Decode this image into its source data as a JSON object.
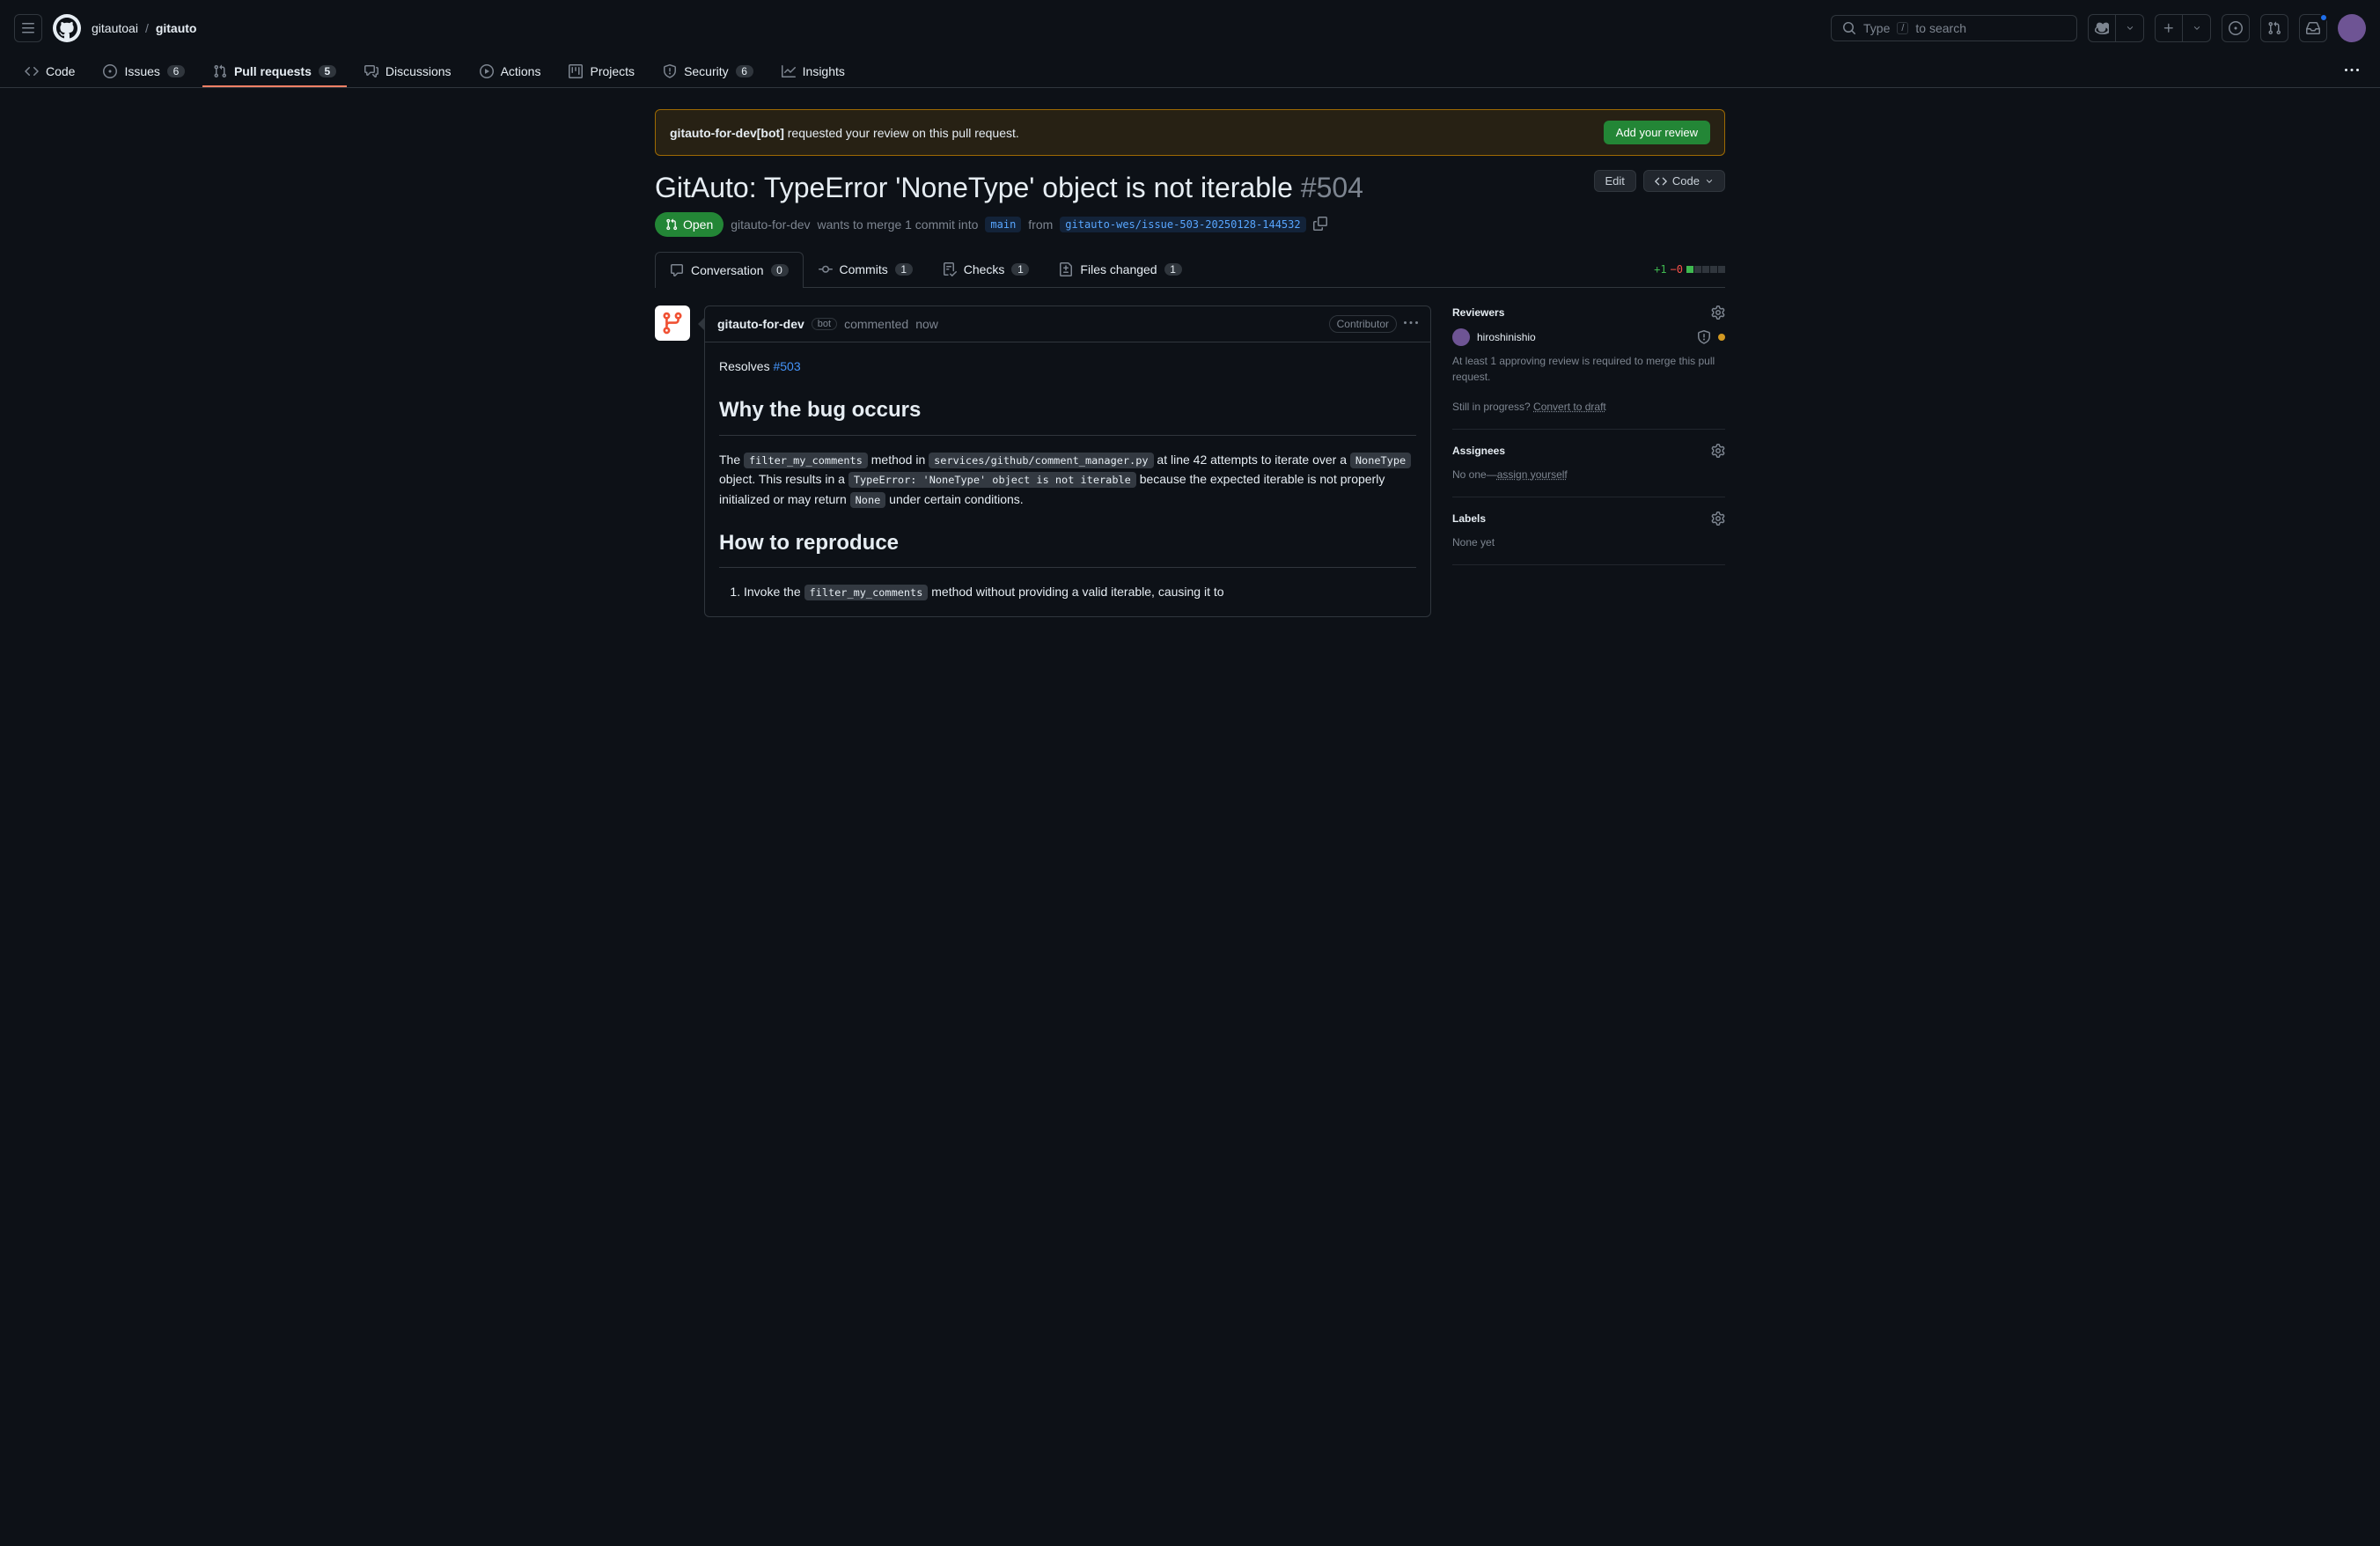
{
  "header": {
    "org": "gitautoai",
    "repo": "gitauto",
    "search_prefix": "Type",
    "search_slash": "/",
    "search_suffix": "to search"
  },
  "nav": {
    "code": "Code",
    "issues": "Issues",
    "issues_count": "6",
    "pulls": "Pull requests",
    "pulls_count": "5",
    "discussions": "Discussions",
    "actions": "Actions",
    "projects": "Projects",
    "security": "Security",
    "security_count": "6",
    "insights": "Insights"
  },
  "banner": {
    "actor": "gitauto-for-dev[bot]",
    "msg": " requested your review on this pull request.",
    "button": "Add your review"
  },
  "pr": {
    "title": "GitAuto: TypeError 'NoneType' object is not iterable",
    "number": "#504",
    "edit": "Edit",
    "code": "Code",
    "state": "Open",
    "author": "gitauto-for-dev",
    "merge_text": "wants to merge 1 commit into",
    "base": "main",
    "from": "from",
    "head": "gitauto-wes/issue-503-20250128-144532"
  },
  "tabs": {
    "conversation": "Conversation",
    "conversation_count": "0",
    "commits": "Commits",
    "commits_count": "1",
    "checks": "Checks",
    "checks_count": "1",
    "files": "Files changed",
    "files_count": "1",
    "diff_add": "+1",
    "diff_del": "−0"
  },
  "comment": {
    "author": "gitauto-for-dev",
    "bot": "bot",
    "action": "commented",
    "time": "now",
    "contributor": "Contributor",
    "resolves_label": "Resolves ",
    "resolves_link": "#503",
    "h_why": "Why the bug occurs",
    "p1_a": "The ",
    "c1": "filter_my_comments",
    "p1_b": " method in ",
    "c2": "services/github/comment_manager.py",
    "p1_c": " at line 42 attempts to iterate over a ",
    "c3": "NoneType",
    "p1_d": " object. This results in a ",
    "c4": "TypeError: 'NoneType' object is not iterable",
    "p1_e": " because the expected iterable is not properly initialized or may return ",
    "c5": "None",
    "p1_f": " under certain conditions.",
    "h_how": "How to reproduce",
    "li1_a": "Invoke the ",
    "li1_c": "filter_my_comments",
    "li1_b": " method without providing a valid iterable, causing it to"
  },
  "sidebar": {
    "reviewers_title": "Reviewers",
    "reviewer_name": "hiroshinishio",
    "reviewers_note": "At least 1 approving review is required to merge this pull request.",
    "draft_prefix": "Still in progress? ",
    "draft_link": "Convert to draft",
    "assignees_title": "Assignees",
    "assignees_none": "No one—",
    "assign_self": "assign yourself",
    "labels_title": "Labels",
    "labels_none": "None yet"
  }
}
